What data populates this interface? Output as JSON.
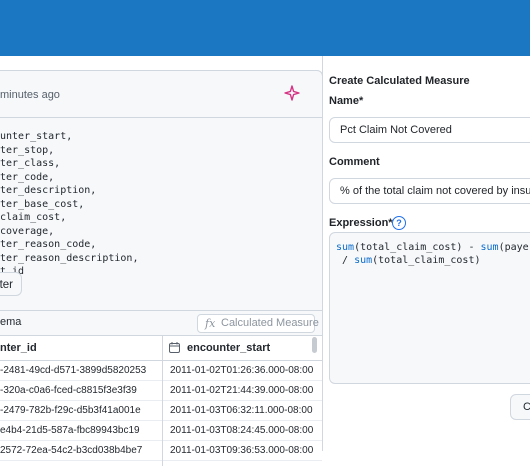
{
  "query": {
    "timestamp": "minutes ago",
    "code_lines": [
      "unter_start,",
      "ter_stop,",
      "ter_class,",
      "ter_code,",
      "ter_description,",
      "ter_base_cost,",
      "claim_cost,",
      "coverage,",
      "ter_reason_code,",
      "ter_reason_description,",
      "t_id"
    ],
    "filter_label": "ter"
  },
  "results": {
    "schema_label": "ema",
    "calc_measure_label": "Calculated Measure",
    "columns": [
      "nter_id",
      "encounter_start"
    ],
    "rows": [
      [
        "-2481-49cd-d571-3899d5820253",
        "2011-01-02T01:26:36.000-08:00"
      ],
      [
        "-320a-c0a6-fced-c8815f3e3f39",
        "2011-01-02T21:44:39.000-08:00"
      ],
      [
        "-2479-782b-f29c-d5b3f41a001e",
        "2011-01-03T06:32:11.000-08:00"
      ],
      [
        "e4b4-21d5-587a-fbc89943bc19",
        "2011-01-03T08:24:45.000-08:00"
      ],
      [
        "2572-72ea-54c2-b3cd038b4be7",
        "2011-01-03T09:36:53.000-08:00"
      ]
    ]
  },
  "measure_form": {
    "title": "Create Calculated Measure",
    "name_label": "Name*",
    "name_value": "Pct Claim Not Covered",
    "comment_label": "Comment",
    "comment_value": "% of the total claim not covered by insurance",
    "expression_label": "Expression*",
    "help_glyph": "?",
    "expression_line1_fn1": "sum",
    "expression_line1_rest1": "(total_claim_cost) - ",
    "expression_line1_fn2": "sum",
    "expression_line1_rest2": "(payer_coverage)",
    "expression_line2_prefix": " / ",
    "expression_line2_fn": "sum",
    "expression_line2_rest": "(total_claim_cost)",
    "cancel_label": "Cancel"
  },
  "colors": {
    "topbar": "#1c77c3",
    "accent": "#1f6feb",
    "sparkle": "#d63384"
  }
}
